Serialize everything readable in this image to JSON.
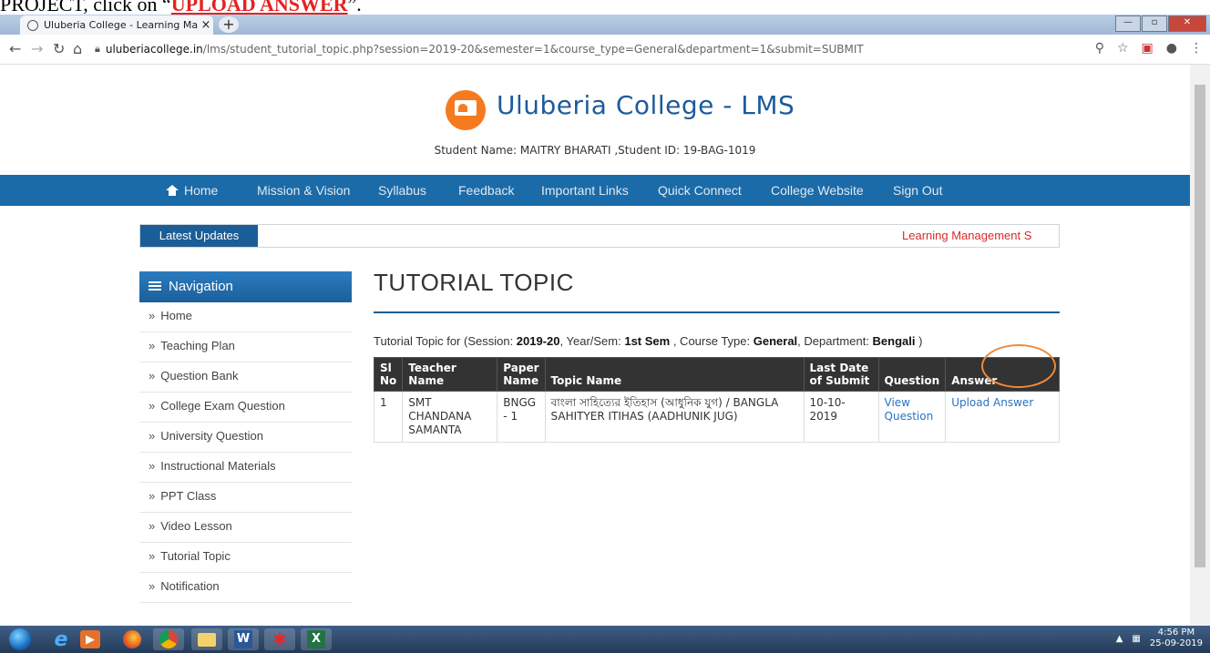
{
  "banner": {
    "prefix": "PROJECT, click on “",
    "highlight": "UPLOAD ANSWER",
    "suffix": "”."
  },
  "browser": {
    "tab_title": "Uluberia College - Learning Man",
    "url_host": "uluberiacollege.in",
    "url_path": "/lms/student_tutorial_topic.php?session=2019-20&semester=1&course_type=General&department=1&submit=SUBMIT"
  },
  "site": {
    "title": "Uluberia College - LMS",
    "student_line": "Student Name: MAITRY BHARATI ,Student ID: 19-BAG-1019"
  },
  "mainnav": [
    "Home",
    "Mission & Vision",
    "Syllabus",
    "Feedback",
    "Important Links",
    "Quick Connect",
    "College Website",
    "Sign Out"
  ],
  "updates": {
    "label": "Latest Updates",
    "text": "Learning Management S"
  },
  "sidebar": {
    "title": "Navigation",
    "items": [
      "Home",
      "Teaching Plan",
      "Question Bank",
      "College Exam Question",
      "University Question",
      "Instructional Materials",
      "PPT Class",
      "Video Lesson",
      "Tutorial Topic",
      "Notification"
    ]
  },
  "content": {
    "title": "TUTORIAL TOPIC",
    "caption": {
      "p1": "Tutorial Topic for (Session: ",
      "session": "2019-20",
      "p2": ", Year/Sem: ",
      "sem": "1st Sem",
      "p3": " , Course Type: ",
      "course": "General",
      "p4": ", Department: ",
      "dept": "Bengali",
      "p5": " )"
    },
    "table": {
      "headers": [
        "Sl No",
        "Teacher Name",
        "Paper Name",
        "Topic Name",
        "Last Date of Submit",
        "Question",
        "Answer"
      ],
      "row": {
        "sl": "1",
        "teacher": "SMT CHANDANA SAMANTA",
        "paper": "BNGG - 1",
        "topic": "বাংলা সাহিত্যের ইতিহাস (আধুনিক যুগ) / BANGLA SAHITYER ITIHAS (AADHUNIK JUG)",
        "last_date": "10-10-2019",
        "question_link": "View Question",
        "answer_link": "Upload Answer"
      }
    }
  },
  "taskbar": {
    "time": "4:56 PM",
    "date": "25-09-2019"
  }
}
